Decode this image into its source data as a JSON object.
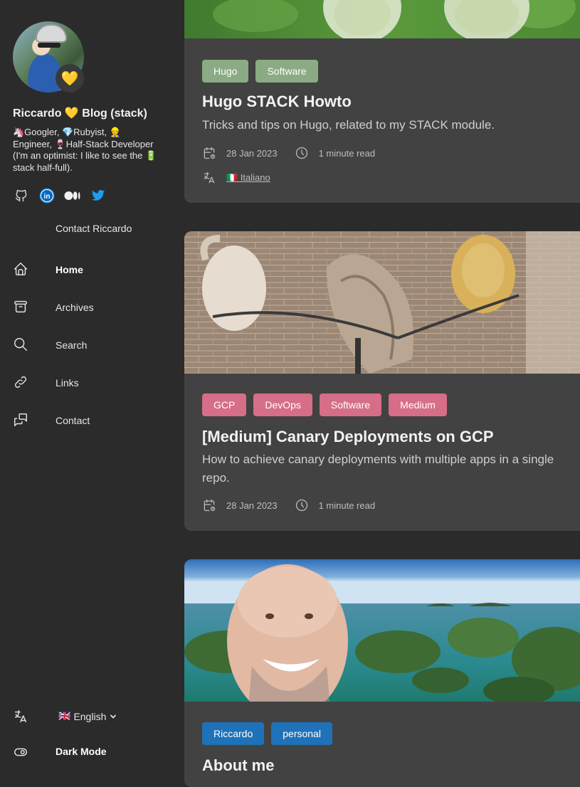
{
  "sidebar": {
    "badge_emoji": "💛",
    "title": "Riccardo 💛 Blog (stack)",
    "description": "🦄Googler, 💎Rubyist, 👷 Engineer, 🍷Half-Stack Developer (I'm an optimist: I like to see the 🔋stack half-full).",
    "social_icons": [
      "github-icon",
      "linkedin-icon",
      "medium-icon",
      "twitter-icon"
    ],
    "contact_top": "Contact Riccardo",
    "menu": [
      {
        "label": "Home",
        "icon": "home-icon",
        "active": true
      },
      {
        "label": "Archives",
        "icon": "archive-icon"
      },
      {
        "label": "Search",
        "icon": "search-icon"
      },
      {
        "label": "Links",
        "icon": "link-icon"
      },
      {
        "label": "Contact",
        "icon": "contact-icon"
      }
    ],
    "language": {
      "flag": "🇬🇧",
      "label": "English"
    },
    "dark_mode_label": "Dark Mode"
  },
  "posts": [
    {
      "tags": [
        "Hugo",
        "Software"
      ],
      "tag_color": "#8aab84",
      "title": "Hugo STACK Howto",
      "subtitle": "Tricks and tips on Hugo, related to my STACK module.",
      "date": "28 Jan 2023",
      "read_time": "1 minute read",
      "translation": "🇮🇹 Italiano"
    },
    {
      "tags": [
        "GCP",
        "DevOps",
        "Software",
        "Medium"
      ],
      "tag_color": "#d56e86",
      "title": "[Medium] Canary Deployments on GCP",
      "subtitle": "How to achieve canary deployments with multiple apps in a single repo.",
      "date": "28 Jan 2023",
      "read_time": "1 minute read"
    },
    {
      "tags": [
        "Riccardo",
        "personal"
      ],
      "tag_color": "#1f72b8",
      "title": "About me"
    }
  ],
  "colors": {
    "background": "#2b2b2b",
    "card": "#424242"
  }
}
